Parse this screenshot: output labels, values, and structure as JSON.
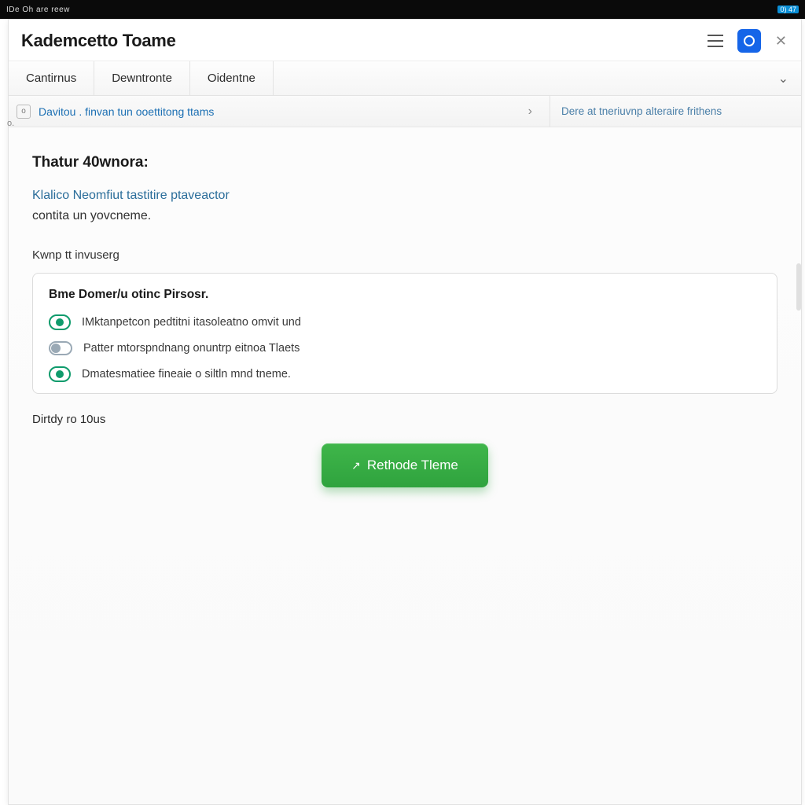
{
  "titlebar": {
    "left_text": "IDe   Oh are reew",
    "tray_text": "0) 47"
  },
  "header": {
    "title": "Kademcetto Toame"
  },
  "tabs": {
    "items": [
      "Cantirnus",
      "Dewntronte",
      "Oidentne"
    ],
    "expand_glyph": "⌄"
  },
  "subheader": {
    "prefix_glyph": "o",
    "left_text": "Davitou . finvan tun ooettitong ttams",
    "arrow_glyph": "›",
    "right_text": "Dere at tneriuvnp alteraire frithens"
  },
  "content": {
    "section_heading": "Thatur 40wnora:",
    "desc_line1": "Klalico Neomfiut tastitire ptaveactor",
    "desc_line2": "contita un yovcneme.",
    "sub_label": "Kwnp tt invuserg",
    "panel": {
      "title": "Bme Domer/u otinc Pirsosr.",
      "options": [
        {
          "state": "on",
          "text": "IMktanpetcon pedtitni itasoleatno omvit und"
        },
        {
          "state": "off",
          "text": "Patter mtorspndnang onuntrp eitnoa Tlaets"
        },
        {
          "state": "on",
          "text": "Dmatesmatiee fineaie o siltln mnd tneme."
        }
      ]
    },
    "footer_label": "Dirtdy ro 10us",
    "primary_button": "Rethode Tleme"
  }
}
